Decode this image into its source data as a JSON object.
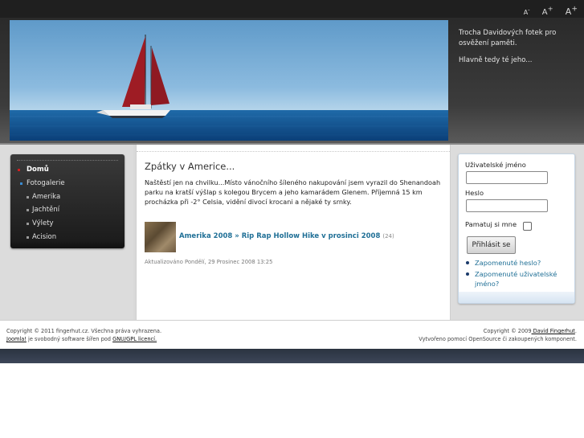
{
  "font_controls": {
    "small": "A",
    "small_sup": "-",
    "medium": "A",
    "medium_sup": "+",
    "large": "A",
    "large_sup": "+"
  },
  "header": {
    "tagline1": "Trocha Davidových fotek pro osvěžení paměti.",
    "tagline2": "Hlavně tedy té jeho..."
  },
  "menu": {
    "items": [
      {
        "label": "Domů",
        "level": 0,
        "active": true
      },
      {
        "label": "Fotogalerie",
        "level": 0,
        "active": false
      },
      {
        "label": "Amerika",
        "level": 1,
        "active": false
      },
      {
        "label": "Jachtění",
        "level": 1,
        "active": false
      },
      {
        "label": "Výlety",
        "level": 1,
        "active": false
      },
      {
        "label": "Acision",
        "level": 1,
        "active": false
      }
    ]
  },
  "article": {
    "title": "Zpátky v Americe...",
    "text": "Naštěstí jen na chvilku...Místo vánočního šíleného nakupování jsem vyrazil do Shenandoah parku na kratší výšlap s kolegou Brycem a jeho kamarádem Glenem. Příjemná 15 km procházka při -2° Celsia, vidění divocí krocani a nějaké ty srnky.",
    "gallery_link": "Amerika 2008 » Rip Rap Hollow Hike v prosinci 2008",
    "gallery_count": "(24)",
    "updated": "Aktualizováno Pondělí, 29 Prosinec 2008 13:25"
  },
  "login": {
    "username_label": "Uživatelské jméno",
    "password_label": "Heslo",
    "remember_label": "Pamatuj si mne",
    "submit_label": "Přihlásit se",
    "forgot_password": "Zapomenuté heslo?",
    "forgot_username": "Zapomenuté uživatelské jméno?"
  },
  "footer": {
    "copyright": "Copyright © 2011 fingerhut.cz. Všechna práva vyhrazena.",
    "joomla_link": "Joomla!",
    "joomla_text": " je svobodný software šířen pod ",
    "license_link": "GNU/GPL licencí.",
    "right_copyright": "Copyright © 2009",
    "right_author": " David Fingerhut",
    "right_line2": "Vytvořeno pomocí OpenSource či zakoupených komponent."
  },
  "colors": {
    "link": "#1f6f96",
    "menu_bg": "#2a2a2a",
    "active_bullet": "#d02020",
    "bullet": "#3a8ad0"
  }
}
